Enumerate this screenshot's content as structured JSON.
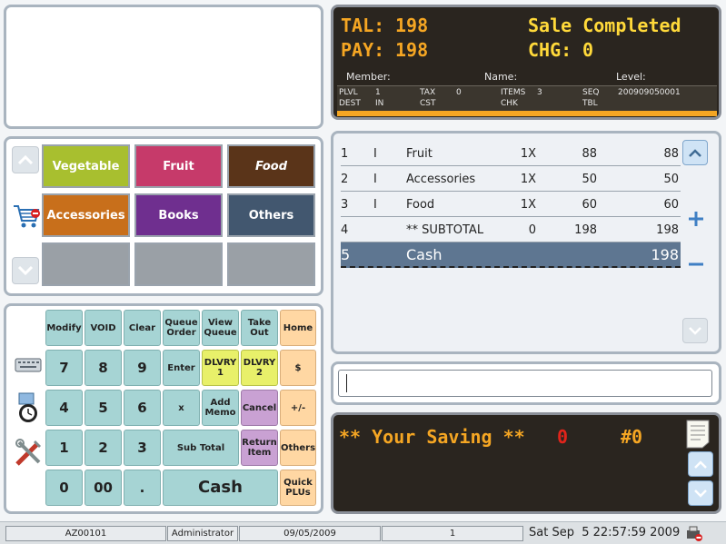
{
  "display": {
    "total_label": "TAL:",
    "total_value": "198",
    "pay_label": "PAY:",
    "pay_value": "198",
    "status": "Sale Completed",
    "change_label": "CHG:",
    "change_value": "0",
    "member_label": "Member:",
    "name_label": "Name:",
    "level_label": "Level:",
    "info": {
      "plvl_label": "PLVL",
      "plvl_value": "1",
      "dest_label": "DEST",
      "dest_value": "IN",
      "tax_label": "TAX",
      "tax_value": "0",
      "cst_label": "CST",
      "items_label": "ITEMS",
      "items_value": "3",
      "chk_label": "CHK",
      "seq_label": "SEQ",
      "seq_value": "200909050001",
      "tbl_label": "TBL"
    }
  },
  "categories": [
    {
      "label": "Vegetable",
      "color": "#a8bf2f"
    },
    {
      "label": "Fruit",
      "color": "#c63a6a"
    },
    {
      "label": "Food",
      "color": "#5a3419"
    },
    {
      "label": "Accessories",
      "color": "#c86f1b"
    },
    {
      "label": "Books",
      "color": "#6f2f8f"
    },
    {
      "label": "Others",
      "color": "#42576f"
    }
  ],
  "items": [
    {
      "no": "1",
      "flag": "I",
      "name": "Fruit",
      "qty": "1X",
      "price": "88",
      "amount": "88"
    },
    {
      "no": "2",
      "flag": "I",
      "name": "Accessories",
      "qty": "1X",
      "price": "50",
      "amount": "50"
    },
    {
      "no": "3",
      "flag": "I",
      "name": "Food",
      "qty": "1X",
      "price": "60",
      "amount": "60"
    },
    {
      "no": "4",
      "flag": "",
      "name": "** SUBTOTAL",
      "qty": "0",
      "price": "198",
      "amount": "198"
    },
    {
      "no": "5",
      "flag": "",
      "name": "Cash",
      "qty": "",
      "price": "",
      "amount": "198"
    }
  ],
  "keys": {
    "modify": "Modify",
    "void": "VOID",
    "clear": "Clear",
    "queue_order": "Queue Order",
    "view_queue": "View Queue",
    "take_out": "Take Out",
    "home": "Home",
    "d7": "7",
    "d8": "8",
    "d9": "9",
    "enter": "Enter",
    "dlvry1": "DLVRY 1",
    "dlvry2": "DLVRY 2",
    "dollar": "$",
    "d4": "4",
    "d5": "5",
    "d6": "6",
    "times": "x",
    "add_memo": "Add Memo",
    "cancel": "Cancel",
    "plusminus": "+/-",
    "d1": "1",
    "d2": "2",
    "d3": "3",
    "subtotal": "Sub Total",
    "return_item": "Return Item",
    "others": "Others",
    "d0": "0",
    "d00": "00",
    "dot": ".",
    "cash": "Cash",
    "quick_plus": "Quick PLUs"
  },
  "saving": {
    "label": "** Your Saving **",
    "value": "0",
    "count": "#0"
  },
  "status_bar": {
    "terminal": "AZ00101",
    "user": "Administrator",
    "date": "09/05/2009",
    "blank": "",
    "count": "1",
    "clock": "Sat Sep  5 22:57:59 2009"
  },
  "colors": {
    "display_bg": "#2a251f",
    "total_orange": "#f5a623",
    "status_yellow": "#ffd93a",
    "saving_red": "#e0241b",
    "selected_row": "#5e7691",
    "key_teal": "#a6d4d4"
  }
}
